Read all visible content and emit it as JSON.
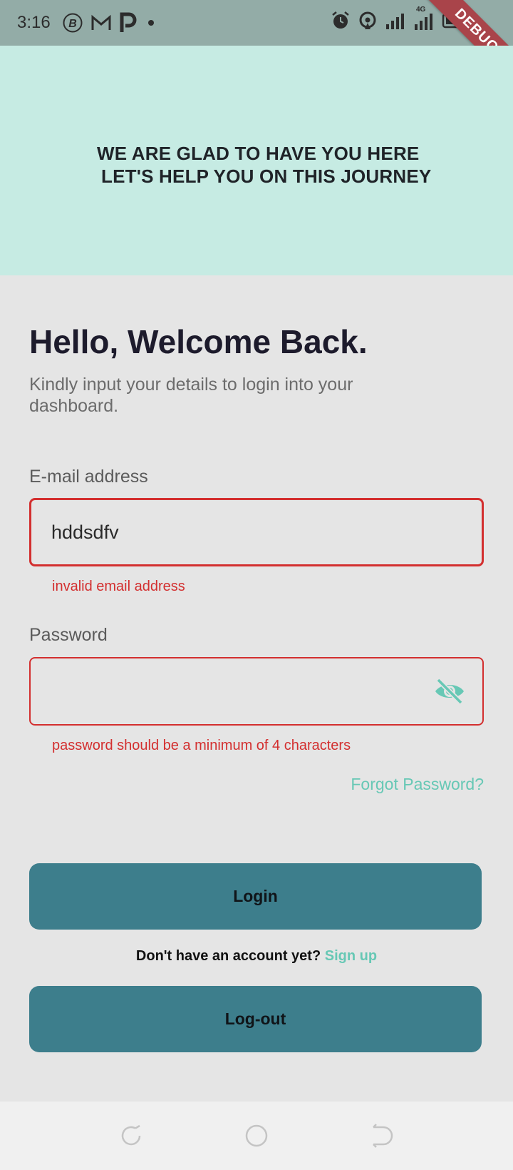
{
  "status_bar": {
    "time": "3:16",
    "network_label": "4G",
    "debug_label": "DEBUG"
  },
  "hero": {
    "line1": "WE ARE GLAD TO HAVE YOU HERE",
    "line2": "LET'S HELP YOU ON THIS JOURNEY"
  },
  "welcome": {
    "title": "Hello, Welcome Back.",
    "subtitle": "Kindly input your details to login into your dashboard."
  },
  "email": {
    "label": "E-mail address",
    "value": "hddsdfv",
    "error": "invalid email address"
  },
  "password": {
    "label": "Password",
    "value": "",
    "error": "password should be a minimum of 4 characters"
  },
  "forgot_password": "Forgot Password?",
  "login_button": "Login",
  "signup": {
    "prompt": "Don't have an account yet?",
    "link": "Sign up"
  },
  "logout_button": "Log-out",
  "colors": {
    "accent": "#67c8b5",
    "button": "#3d7e8c",
    "error": "#d32f2f",
    "hero_bg": "#c6ebe3"
  },
  "icons": [
    "alarm-icon",
    "hotspot-icon",
    "signal-icon",
    "battery-icon",
    "eye-off-icon",
    "recent-apps-icon",
    "home-icon",
    "back-icon"
  ]
}
